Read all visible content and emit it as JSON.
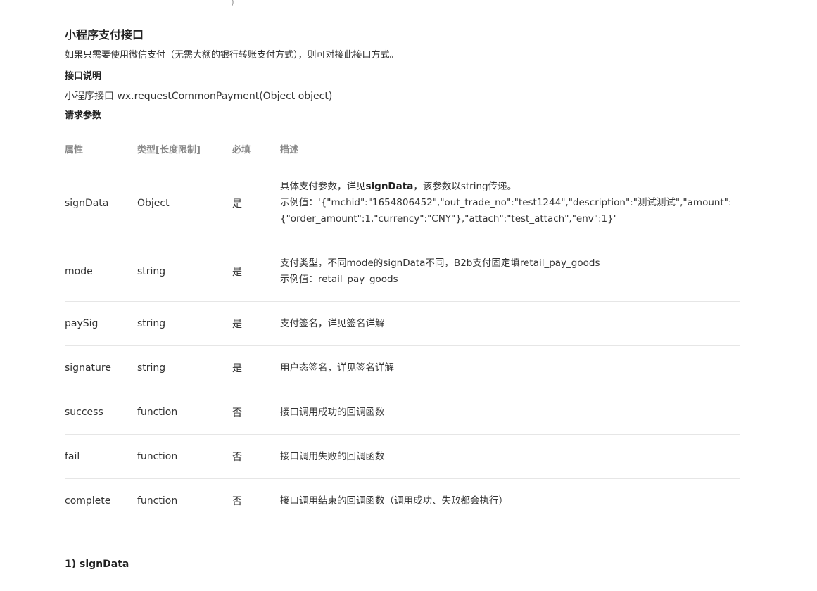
{
  "page": {
    "top_fragment": ")",
    "title": "小程序支付接口",
    "intro": "如果只需要使用微信支付（无需大额的银行转账支付方式），则可对接此接口方式。",
    "interface_heading": "接口说明",
    "api_signature": "小程序接口 wx.requestCommonPayment(Object object)",
    "params_heading": "请求参数",
    "next_section_heading": "1) signData"
  },
  "table": {
    "headers": {
      "name": "属性",
      "type": "类型[长度限制]",
      "required": "必填",
      "description": "描述"
    },
    "rows": [
      {
        "name": "signData",
        "type": "Object",
        "required": "是",
        "desc_prefix": "具体支付参数，详见",
        "desc_bold": "signData",
        "desc_suffix": "，该参数以string传递。",
        "desc_example": "示例值：'{\"mchid\":\"1654806452\",\"out_trade_no\":\"test1244\",\"description\":\"测试测试\",\"amount\":{\"order_amount\":1,\"currency\":\"CNY\"},\"attach\":\"test_attach\",\"env\":1}'"
      },
      {
        "name": "mode",
        "type": "string",
        "required": "是",
        "desc_line1": "支付类型，不同mode的signData不同，B2b支付固定填retail_pay_goods",
        "desc_line2": "示例值：retail_pay_goods"
      },
      {
        "name": "paySig",
        "type": "string",
        "required": "是",
        "desc_line1": "支付签名，详见签名详解"
      },
      {
        "name": "signature",
        "type": "string",
        "required": "是",
        "desc_line1": "用户态签名，详见签名详解"
      },
      {
        "name": "success",
        "type": "function",
        "required": "否",
        "desc_line1": "接口调用成功的回调函数"
      },
      {
        "name": "fail",
        "type": "function",
        "required": "否",
        "desc_line1": "接口调用失败的回调函数"
      },
      {
        "name": "complete",
        "type": "function",
        "required": "否",
        "desc_line1": "接口调用结束的回调函数（调用成功、失败都会执行）"
      }
    ]
  }
}
